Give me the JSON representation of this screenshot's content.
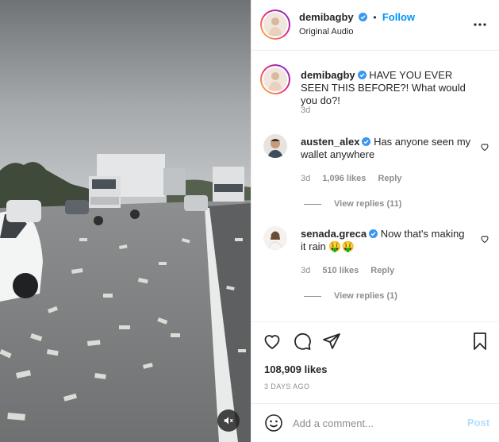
{
  "header": {
    "username": "demibagby",
    "dot": "•",
    "follow_label": "Follow",
    "audio": "Original Audio"
  },
  "caption": {
    "username": "demibagby",
    "text": "HAVE YOU EVER SEEN THIS BEFORE?! What would you do?!",
    "time": "3d"
  },
  "comments": [
    {
      "username": "austen_alex",
      "text": "Has anyone seen my wallet anywhere",
      "time": "3d",
      "likes": "1,096 likes",
      "reply_label": "Reply",
      "view_replies": "View replies (11)"
    },
    {
      "username": "senada.greca",
      "text": "Now that's making it rain 🤑🤑",
      "time": "3d",
      "likes": "510 likes",
      "reply_label": "Reply",
      "view_replies": "View replies (1)"
    }
  ],
  "actions": {
    "likes": "108,909 likes",
    "ago": "3 days ago"
  },
  "add_comment": {
    "placeholder": "Add a comment...",
    "post_label": "Post"
  },
  "colors": {
    "accent": "#0095f6",
    "verified": "#3897f0",
    "muted": "#8e8e8e",
    "post_disabled": "#b2dffc"
  },
  "icons": {
    "more": "more-horizontal-icon",
    "like": "heart-icon",
    "comment": "comment-icon",
    "share": "paper-plane-icon",
    "save": "bookmark-icon",
    "emoji": "smiley-icon",
    "mute": "speaker-muted-icon"
  }
}
